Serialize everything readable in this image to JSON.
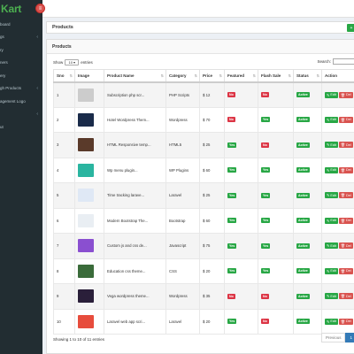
{
  "brand": {
    "prefix": "",
    "accent": "Kart",
    "accent_color": "#4caf50"
  },
  "sidebar": {
    "items": [
      {
        "label": "board",
        "chevron": false
      },
      {
        "label": "gs",
        "chevron": true
      },
      {
        "label": "ry",
        "chevron": false
      },
      {
        "label": "ners",
        "chevron": false
      },
      {
        "label": "ery",
        "chevron": false
      },
      {
        "label": "gh Products",
        "chevron": true
      },
      {
        "label": "agement Logo",
        "chevron": false
      },
      {
        "label": "",
        "chevron": true
      },
      {
        "label": "ut",
        "chevron": false
      }
    ]
  },
  "header": {
    "title": "Products",
    "toggle_icon": "menu-icon",
    "add_icon": "plus-icon"
  },
  "panel": {
    "title": "Products",
    "show_label": "Show",
    "entries_value": "10",
    "entries_label": "entries",
    "search_label": "Search:"
  },
  "table": {
    "columns": [
      "Sno",
      "Image",
      "Product Name",
      "Category",
      "Price",
      "Featured",
      "Flash Sale",
      "Status",
      "Action"
    ],
    "rows": [
      {
        "sno": "1",
        "name": "Subscription php scr...",
        "category": "PHP Scripts",
        "price": "$ 12",
        "featured": "No",
        "flash": "No",
        "status": "Active",
        "thumb": "#ccc"
      },
      {
        "sno": "2",
        "name": "Hotel Wordpress Them...",
        "category": "Wordpress",
        "price": "$ 70",
        "featured": "No",
        "flash": "Yes",
        "status": "Active",
        "thumb": "#1a2b4a"
      },
      {
        "sno": "3",
        "name": "HTML Responsive temp...",
        "category": "HTML5",
        "price": "$ 25",
        "featured": "Yes",
        "flash": "No",
        "status": "Active",
        "thumb": "#5a3a2a"
      },
      {
        "sno": "4",
        "name": "Wp menu plugin...",
        "category": "WP Plugins",
        "price": "$ 60",
        "featured": "Yes",
        "flash": "Yes",
        "status": "Active",
        "thumb": "#2ab5a0"
      },
      {
        "sno": "5",
        "name": "Time tracking larave...",
        "category": "Laravel",
        "price": "$ 25",
        "featured": "Yes",
        "flash": "Yes",
        "status": "Active",
        "thumb": "#dfe8f5"
      },
      {
        "sno": "6",
        "name": "Modern Bootstrap The...",
        "category": "Bootstrap",
        "price": "$ 60",
        "featured": "Yes",
        "flash": "Yes",
        "status": "Active",
        "thumb": "#e9eef3"
      },
      {
        "sno": "7",
        "name": "Custom js and css de...",
        "category": "Javascript",
        "price": "$ 75",
        "featured": "Yes",
        "flash": "Yes",
        "status": "Active",
        "thumb": "#8a4fd0"
      },
      {
        "sno": "8",
        "name": "Education css theme...",
        "category": "CSS",
        "price": "$ 20",
        "featured": "Yes",
        "flash": "Yes",
        "status": "Active",
        "thumb": "#3a6b3a"
      },
      {
        "sno": "9",
        "name": "Vega wordpress theme...",
        "category": "Wordpress",
        "price": "$ 35",
        "featured": "No",
        "flash": "No",
        "status": "Active",
        "thumb": "#2a1f3a"
      },
      {
        "sno": "10",
        "name": "Laravel web app scri...",
        "category": "Laravel",
        "price": "$ 20",
        "featured": "Yes",
        "flash": "No",
        "status": "Active",
        "thumb": "#e74c3c"
      }
    ],
    "edit_label": "Edit",
    "delete_label": "Del",
    "edit_icon": "pencil-icon",
    "delete_icon": "trash-icon"
  },
  "footer": {
    "info": "Showing 1 to 10 of 11 entries",
    "prev": "Previous",
    "page": "1"
  }
}
